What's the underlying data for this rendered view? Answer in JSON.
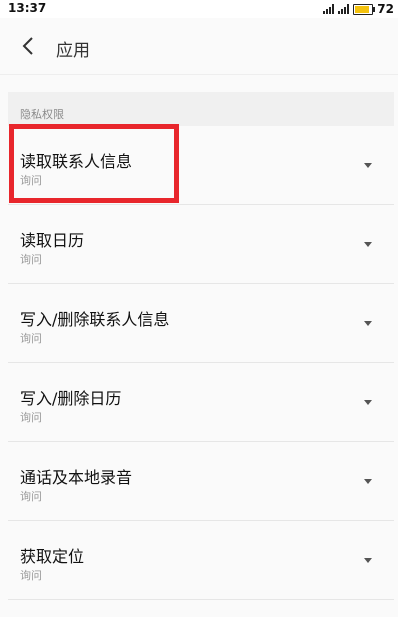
{
  "status_bar": {
    "time": "13:37",
    "battery": "72",
    "battery_color": "#f4c20d"
  },
  "nav": {
    "back_icon": "chevron-left-icon",
    "title": "应用"
  },
  "section": {
    "label": "隐私权限"
  },
  "permissions": [
    {
      "title": "读取联系人信息",
      "value": "询问"
    },
    {
      "title": "读取日历",
      "value": "询问"
    },
    {
      "title": "写入/删除联系人信息",
      "value": "询问"
    },
    {
      "title": "写入/删除日历",
      "value": "询问"
    },
    {
      "title": "通话及本地录音",
      "value": "询问"
    },
    {
      "title": "获取定位",
      "value": "询问"
    }
  ],
  "highlight_color": "#e8262c"
}
